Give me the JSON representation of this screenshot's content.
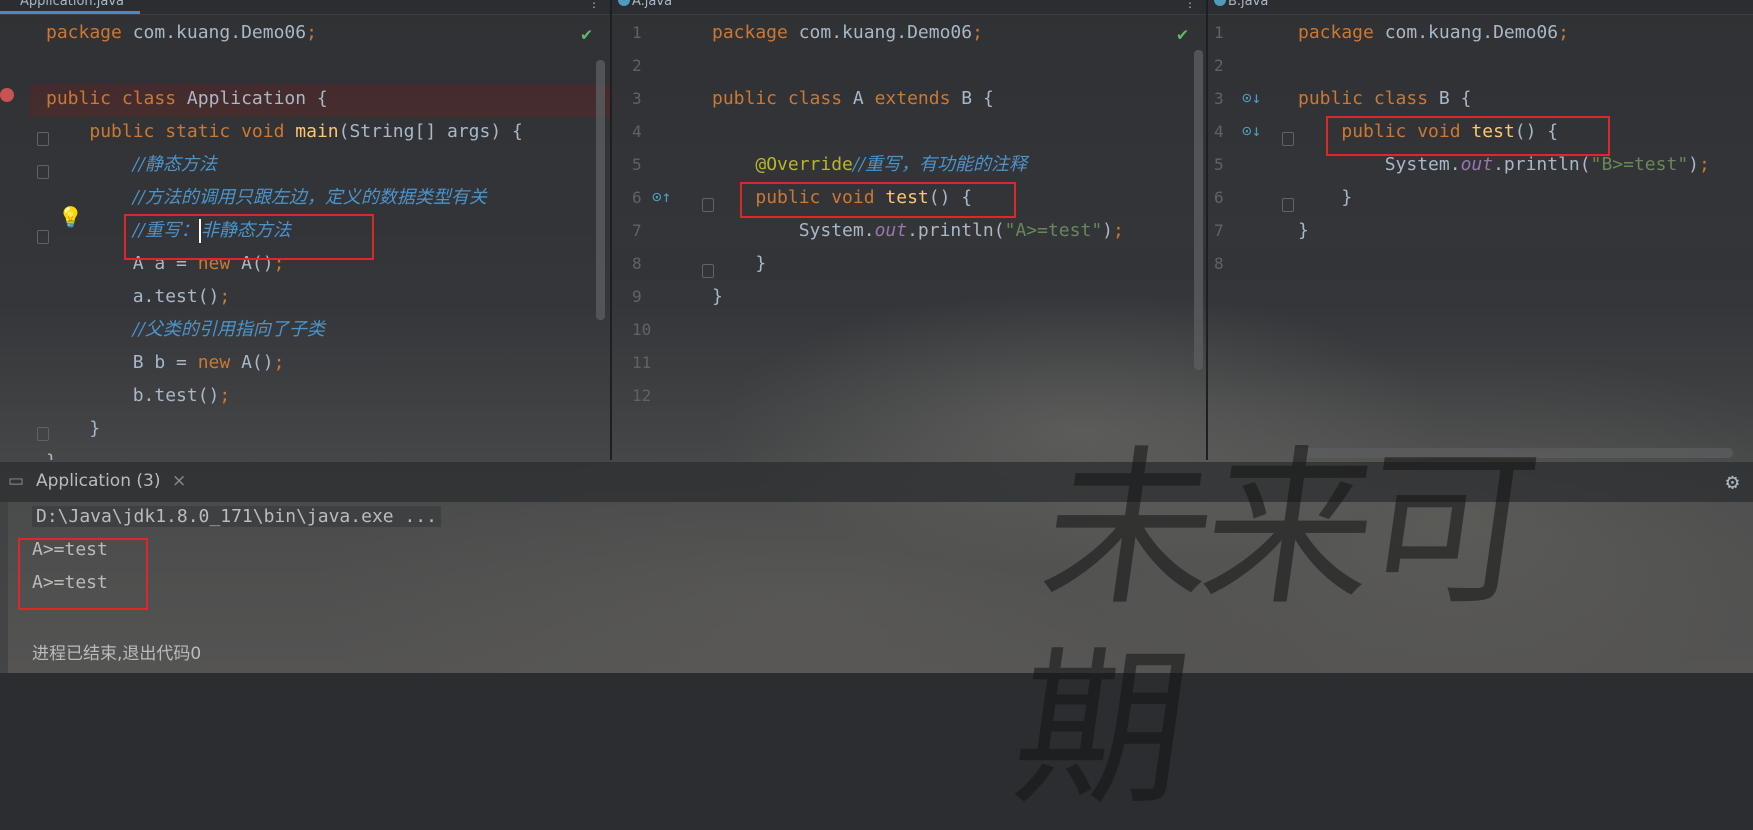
{
  "tabs": {
    "pane1": "Application.java",
    "pane2": "A.java",
    "pane3": "B.java"
  },
  "pane1": {
    "lines": [
      {
        "num": "",
        "parts": [
          {
            "c": "kw",
            "t": "package "
          },
          {
            "c": "",
            "t": "com.kuang.Demo06"
          },
          {
            "c": "kw",
            "t": ";"
          }
        ]
      },
      {
        "num": "",
        "parts": []
      },
      {
        "num": "",
        "parts": [
          {
            "c": "kw",
            "t": "public class "
          },
          {
            "c": "",
            "t": "Application {"
          }
        ]
      },
      {
        "num": "",
        "parts": [
          {
            "c": "",
            "t": "    "
          },
          {
            "c": "kw",
            "t": "public static void "
          },
          {
            "c": "fn",
            "t": "main"
          },
          {
            "c": "",
            "t": "(String[] args) {"
          }
        ]
      },
      {
        "num": "",
        "parts": [
          {
            "c": "",
            "t": "        "
          },
          {
            "c": "cmt",
            "t": "//静态方法"
          }
        ]
      },
      {
        "num": "",
        "parts": [
          {
            "c": "",
            "t": "        "
          },
          {
            "c": "cmt",
            "t": "//方法的调用只跟左边，定义的数据类型有关"
          }
        ]
      },
      {
        "num": "",
        "parts": [
          {
            "c": "",
            "t": "        "
          },
          {
            "c": "cmt",
            "t": "//重写："
          },
          {
            "c": "caret",
            "t": ""
          },
          {
            "c": "cmt",
            "t": "非静态方法"
          }
        ]
      },
      {
        "num": "",
        "parts": [
          {
            "c": "",
            "t": "        A a = "
          },
          {
            "c": "kw",
            "t": "new "
          },
          {
            "c": "",
            "t": "A()"
          },
          {
            "c": "kw",
            "t": ";"
          }
        ]
      },
      {
        "num": "",
        "parts": [
          {
            "c": "",
            "t": "        a.test()"
          },
          {
            "c": "kw",
            "t": ";"
          }
        ]
      },
      {
        "num": "",
        "parts": [
          {
            "c": "",
            "t": "        "
          },
          {
            "c": "cmt",
            "t": "//父类的引用指向了子类"
          }
        ]
      },
      {
        "num": "",
        "parts": [
          {
            "c": "",
            "t": "        B b = "
          },
          {
            "c": "kw",
            "t": "new "
          },
          {
            "c": "",
            "t": "A()"
          },
          {
            "c": "kw",
            "t": ";"
          }
        ]
      },
      {
        "num": "",
        "parts": [
          {
            "c": "",
            "t": "        b.test()"
          },
          {
            "c": "kw",
            "t": ";"
          }
        ]
      },
      {
        "num": "",
        "parts": [
          {
            "c": "",
            "t": "    }"
          }
        ]
      },
      {
        "num": "",
        "parts": [
          {
            "c": "",
            "t": "}"
          }
        ]
      }
    ]
  },
  "pane2": {
    "lines": [
      {
        "num": "1",
        "parts": [
          {
            "c": "kw",
            "t": "package "
          },
          {
            "c": "",
            "t": "com.kuang.Demo06"
          },
          {
            "c": "kw",
            "t": ";"
          }
        ]
      },
      {
        "num": "2",
        "parts": []
      },
      {
        "num": "3",
        "parts": [
          {
            "c": "kw",
            "t": "public class "
          },
          {
            "c": "",
            "t": "A "
          },
          {
            "c": "kw",
            "t": "extends "
          },
          {
            "c": "",
            "t": "B {"
          }
        ]
      },
      {
        "num": "4",
        "parts": []
      },
      {
        "num": "5",
        "parts": [
          {
            "c": "",
            "t": "    "
          },
          {
            "c": "ann",
            "t": "@Override"
          },
          {
            "c": "cmt",
            "t": "//重写，有功能的注释"
          }
        ]
      },
      {
        "num": "6",
        "parts": [
          {
            "c": "",
            "t": "    "
          },
          {
            "c": "kw",
            "t": "public void "
          },
          {
            "c": "fn",
            "t": "test"
          },
          {
            "c": "",
            "t": "() {"
          }
        ]
      },
      {
        "num": "7",
        "parts": [
          {
            "c": "",
            "t": "        System."
          },
          {
            "c": "field",
            "t": "out"
          },
          {
            "c": "",
            "t": ".println("
          },
          {
            "c": "str",
            "t": "\"A>=test\""
          },
          {
            "c": "",
            "t": ")"
          },
          {
            "c": "kw",
            "t": ";"
          }
        ]
      },
      {
        "num": "8",
        "parts": [
          {
            "c": "",
            "t": "    }"
          }
        ]
      },
      {
        "num": "9",
        "parts": [
          {
            "c": "",
            "t": "}"
          }
        ]
      },
      {
        "num": "10",
        "parts": []
      },
      {
        "num": "11",
        "parts": []
      },
      {
        "num": "12",
        "parts": []
      }
    ]
  },
  "pane3": {
    "lines": [
      {
        "num": "1",
        "parts": [
          {
            "c": "kw",
            "t": "package "
          },
          {
            "c": "",
            "t": "com.kuang.Demo06"
          },
          {
            "c": "kw",
            "t": ";"
          }
        ]
      },
      {
        "num": "2",
        "parts": []
      },
      {
        "num": "3",
        "parts": [
          {
            "c": "kw",
            "t": "public class "
          },
          {
            "c": "",
            "t": "B {"
          }
        ]
      },
      {
        "num": "4",
        "parts": [
          {
            "c": "",
            "t": "    "
          },
          {
            "c": "kw",
            "t": "public void "
          },
          {
            "c": "fn",
            "t": "test"
          },
          {
            "c": "",
            "t": "() {"
          }
        ]
      },
      {
        "num": "5",
        "parts": [
          {
            "c": "",
            "t": "        System."
          },
          {
            "c": "field",
            "t": "out"
          },
          {
            "c": "",
            "t": ".println("
          },
          {
            "c": "str",
            "t": "\"B>=test\""
          },
          {
            "c": "",
            "t": ")"
          },
          {
            "c": "kw",
            "t": ";"
          }
        ]
      },
      {
        "num": "6",
        "parts": [
          {
            "c": "",
            "t": "    }"
          }
        ]
      },
      {
        "num": "7",
        "parts": [
          {
            "c": "",
            "t": "}"
          }
        ]
      },
      {
        "num": "8",
        "parts": []
      }
    ]
  },
  "console": {
    "tab_label": "Application (3)",
    "close_glyph": "×",
    "command": "D:\\Java\\jdk1.8.0_171\\bin\\java.exe ...",
    "output": [
      "A>=test",
      "A>=test"
    ],
    "exit_message": "进程已结束,退出代码0"
  },
  "watermark": "未来可期",
  "colors": {
    "keyword": "#cc7832",
    "function": "#ffc66d",
    "string": "#6a8759",
    "comment": "#4c93c9",
    "annotation": "#bbb529",
    "highlight_box": "#e0262d"
  }
}
